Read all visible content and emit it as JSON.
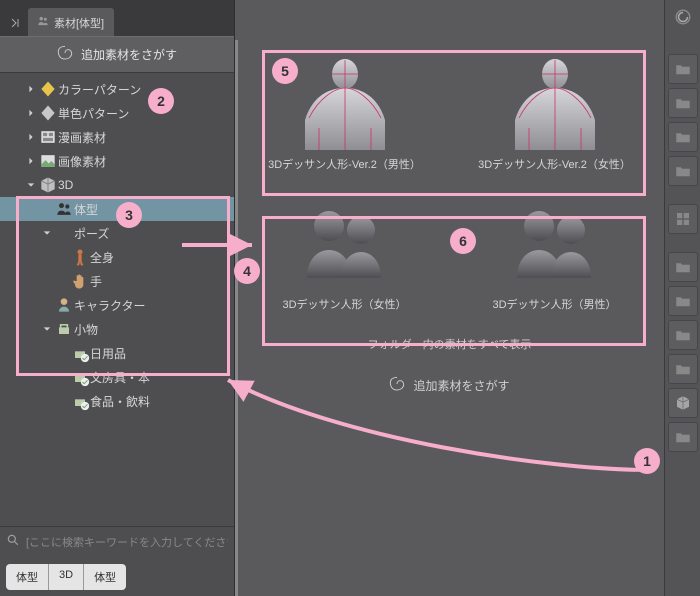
{
  "tab": {
    "label": "素材[体型]"
  },
  "header": {
    "find_more": "追加素材をさがす"
  },
  "tree": {
    "items": [
      {
        "label": "カラーパターン",
        "indent": 1,
        "arrow": "right",
        "icon": "diamond-yellow"
      },
      {
        "label": "単色パターン",
        "indent": 1,
        "arrow": "right",
        "icon": "diamond-gray"
      },
      {
        "label": "漫画素材",
        "indent": 1,
        "arrow": "right",
        "icon": "manga"
      },
      {
        "label": "画像素材",
        "indent": 1,
        "arrow": "right",
        "icon": "image"
      },
      {
        "label": "3D",
        "indent": 1,
        "arrow": "down",
        "icon": "cube"
      },
      {
        "label": "体型",
        "indent": 2,
        "arrow": "none",
        "icon": "people",
        "selected": true
      },
      {
        "label": "ポーズ",
        "indent": 2,
        "arrow": "down",
        "icon": "none"
      },
      {
        "label": "全身",
        "indent": 3,
        "arrow": "none",
        "icon": "person-red"
      },
      {
        "label": "手",
        "indent": 3,
        "arrow": "none",
        "icon": "hand"
      },
      {
        "label": "キャラクター",
        "indent": 2,
        "arrow": "none",
        "icon": "character"
      },
      {
        "label": "小物",
        "indent": 2,
        "arrow": "down",
        "icon": "prop"
      },
      {
        "label": "日用品",
        "indent": 3,
        "arrow": "none",
        "icon": "prop-q"
      },
      {
        "label": "文房具・本",
        "indent": 3,
        "arrow": "none",
        "icon": "prop-q"
      },
      {
        "label": "食品・飲料",
        "indent": 3,
        "arrow": "none",
        "icon": "prop-q"
      }
    ]
  },
  "search": {
    "placeholder": "[ここに検索キーワードを入力してください]"
  },
  "breadcrumbs": {
    "items": [
      "体型",
      "3D",
      "体型"
    ]
  },
  "main": {
    "row1": [
      {
        "label": "3Dデッサン人形-Ver.2（男性）",
        "kind": "figure"
      },
      {
        "label": "3Dデッサン人形-Ver.2（女性）",
        "kind": "figure"
      }
    ],
    "row2": [
      {
        "label": "3Dデッサン人形（女性）",
        "kind": "silhouette"
      },
      {
        "label": "3Dデッサン人形（男性）",
        "kind": "silhouette"
      }
    ],
    "show_all": "フォルダー内の素材をすべて表示",
    "find_more": "追加素材をさがす"
  },
  "annotations": {
    "1": "1",
    "2": "2",
    "3": "3",
    "4": "4",
    "5": "5",
    "6": "6"
  }
}
